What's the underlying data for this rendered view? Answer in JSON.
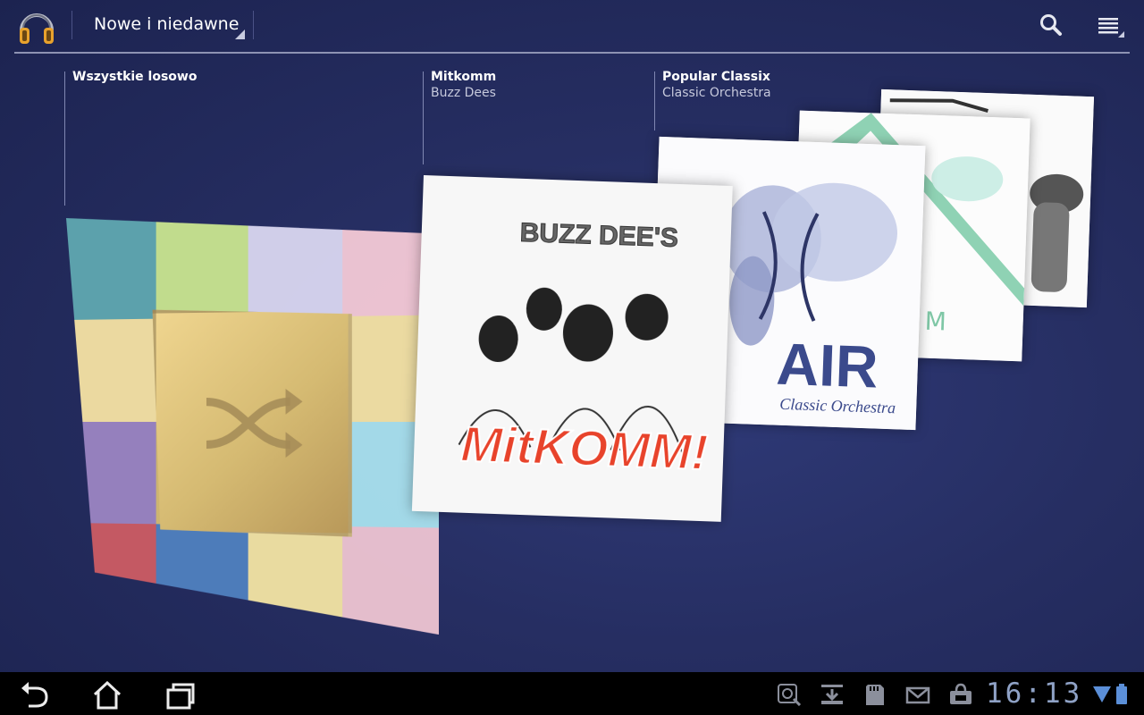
{
  "action_bar": {
    "app_icon": "headphones-icon",
    "nav_label": "Nowe i niedawne",
    "search_icon": "search-icon",
    "menu_icon": "menu-icon"
  },
  "carousel": [
    {
      "title": "Wszystkie losowo",
      "subtitle": "",
      "art": "shuffle-tile"
    },
    {
      "title": "Mitkomm",
      "subtitle": "Buzz Dees",
      "art_text_top": "BUZZ DEE'S",
      "art_text_main": "MitKOMM!"
    },
    {
      "title": "Popular Classix",
      "subtitle": "Classic Orchestra",
      "art_text_main": "AIR",
      "art_text_sub": "Classic Orchestra",
      "art_text_m": "M"
    }
  ],
  "status_bar": {
    "back_icon": "back-icon",
    "home_icon": "home-icon",
    "recent_icon": "recent-apps-icon",
    "notification_icons": [
      "debug-icon",
      "download-icon",
      "sd-card-icon",
      "gmail-icon",
      "market-icon"
    ],
    "time": "16:13",
    "wifi_icon": "wifi-icon",
    "battery_icon": "battery-icon"
  },
  "colors": {
    "background": "#262e62",
    "divider": "#8e93b3",
    "clock": "#8fa2c6",
    "shuffle_tiles": [
      "#5fa7b0",
      "#c9e58f",
      "#d9d6f0",
      "#f4c9d6",
      "#f5e1a3",
      "#efd58f",
      "#d5ba72",
      "#f4e3a3",
      "#9b84c2",
      "#d5ba72",
      "#b9995a",
      "#a9e1ee",
      "#cc5b63",
      "#4f7fbf",
      "#f3e4a3",
      "#eec4d2"
    ]
  }
}
